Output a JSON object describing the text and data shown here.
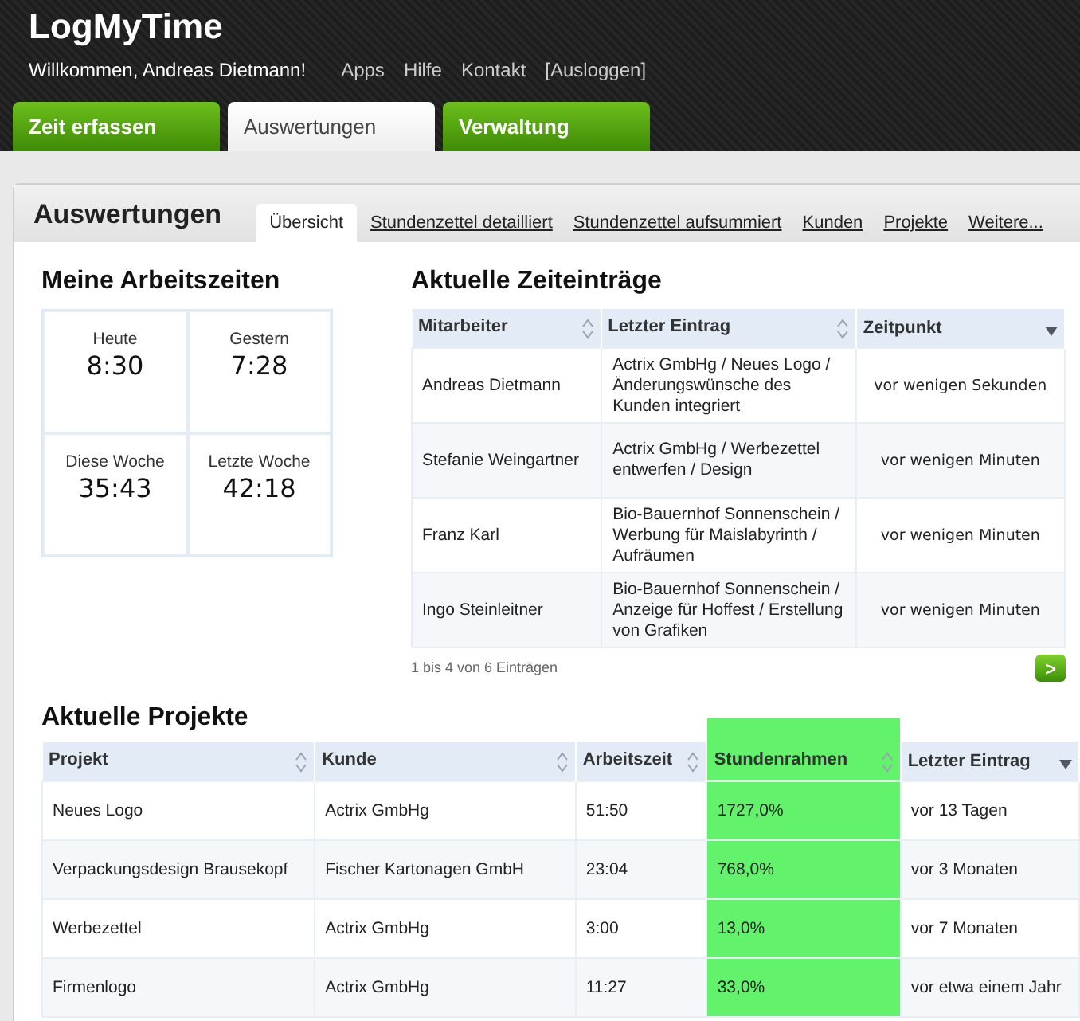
{
  "app": {
    "logo": "LogMyTime",
    "welcome": "Willkommen, Andreas Dietmann!",
    "links": [
      "Apps",
      "Hilfe",
      "Kontakt",
      "[Ausloggen]"
    ]
  },
  "main_tabs": [
    {
      "label": "Zeit erfassen",
      "selected": false
    },
    {
      "label": "Auswertungen",
      "selected": true
    },
    {
      "label": "Verwaltung",
      "selected": false
    }
  ],
  "panel": {
    "title": "Auswertungen",
    "tabs": [
      {
        "label": "Übersicht",
        "selected": true
      },
      {
        "label": "Stundenzettel detailliert",
        "selected": false
      },
      {
        "label": "Stundenzettel aufsummiert",
        "selected": false
      },
      {
        "label": "Kunden",
        "selected": false
      },
      {
        "label": "Projekte",
        "selected": false
      },
      {
        "label": "Weitere...",
        "selected": false
      }
    ]
  },
  "work_times": {
    "title": "Meine Arbeitszeiten",
    "cells": [
      {
        "label": "Heute",
        "value": "8:30"
      },
      {
        "label": "Gestern",
        "value": "7:28"
      },
      {
        "label": "Diese Woche",
        "value": "35:43"
      },
      {
        "label": "Letzte Woche",
        "value": "42:18"
      }
    ]
  },
  "entries": {
    "title": "Aktuelle Zeiteinträge",
    "columns": [
      {
        "label": "Mitarbeiter",
        "sorted": false
      },
      {
        "label": "Letzter Eintrag",
        "sorted": false
      },
      {
        "label": "Zeitpunkt",
        "sorted": true
      }
    ],
    "rows": [
      [
        "Andreas Dietmann",
        "Actrix GmbHg / Neues Logo / Änderungswünsche des Kunden integriert",
        "vor wenigen Sekunden"
      ],
      [
        "Stefanie Weingartner",
        "Actrix GmbHg / Werbezettel entwerfen / Design",
        "vor wenigen Minuten"
      ],
      [
        "Franz Karl",
        "Bio-Bauernhof Sonnenschein / Werbung für Maislabyrinth / Aufräumen",
        "vor wenigen Minuten"
      ],
      [
        "Ingo Steinleitner",
        "Bio-Bauernhof Sonnenschein / Anzeige für Hoffest / Erstellung von Grafiken",
        "vor wenigen Minuten"
      ]
    ],
    "info": "1 bis 4 von 6 Einträgen",
    "next": ">"
  },
  "projects": {
    "title": "Aktuelle Projekte",
    "columns": [
      {
        "label": "Projekt",
        "sorted": false,
        "highlighted": false
      },
      {
        "label": "Kunde",
        "sorted": false,
        "highlighted": false
      },
      {
        "label": "Arbeitszeit",
        "sorted": false,
        "highlighted": false
      },
      {
        "label": "Stundenrahmen",
        "sorted": false,
        "highlighted": true
      },
      {
        "label": "Letzter Eintrag",
        "sorted": true,
        "highlighted": false
      }
    ],
    "rows": [
      [
        "Neues Logo",
        "Actrix GmbHg",
        "51:50",
        "1727,0%",
        "vor 13 Tagen"
      ],
      [
        "Verpackungsdesign Brausekopf",
        "Fischer Kartonagen GmbH",
        "23:04",
        "768,0%",
        "vor 3 Monaten"
      ],
      [
        "Werbezettel",
        "Actrix GmbHg",
        "3:00",
        "13,0%",
        "vor 7 Monaten"
      ],
      [
        "Firmenlogo",
        "Actrix GmbHg",
        "11:27",
        "33,0%",
        "vor etwa einem Jahr"
      ]
    ]
  }
}
